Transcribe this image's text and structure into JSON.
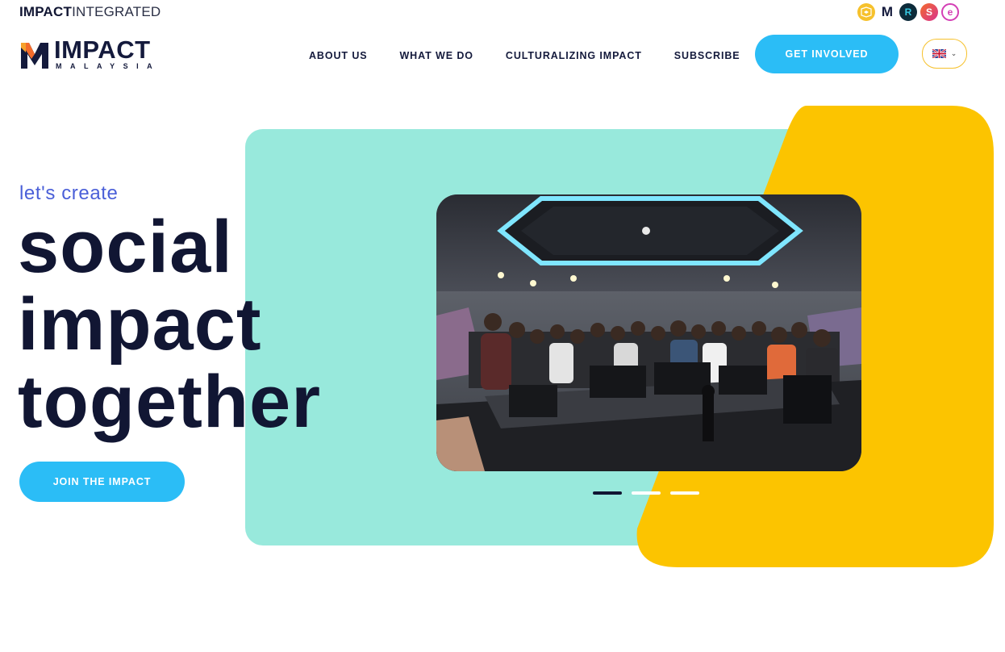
{
  "topbar": {
    "brand_bold": "IMPACT",
    "brand_light": "INTEGRATED",
    "brand_icons": [
      {
        "name": "mobius-icon",
        "glyph": "⟳",
        "color": "#f6c12c"
      },
      {
        "name": "impact-m-icon",
        "glyph": "M",
        "color": "#141a3c"
      },
      {
        "name": "r-brand-icon",
        "glyph": "R",
        "color": "#0b6f8a"
      },
      {
        "name": "s-brand-icon",
        "glyph": "S",
        "color": "#e54b4b"
      },
      {
        "name": "e-brand-icon",
        "glyph": "e",
        "color": "#d43fb5"
      }
    ]
  },
  "logo": {
    "title": "IMPACT",
    "subtitle": "MALAYSIA"
  },
  "nav": {
    "items": [
      "ABOUT US",
      "WHAT WE DO",
      "CULTURALIZING IMPACT",
      "SUBSCRIBE"
    ],
    "cta_label": "GET INVOLVED",
    "language_flag": "uk-flag-icon"
  },
  "hero": {
    "eyebrow": "let's create",
    "headline_lines": [
      "social",
      "impact",
      "together"
    ],
    "button_label": "JOIN THE IMPACT",
    "slides_total": 3,
    "active_slide": 1
  },
  "colors": {
    "accent_blue": "#2bbdf6",
    "teal": "#98e9dc",
    "yellow": "#fcc400",
    "navy": "#111633",
    "eyebrow": "#4a5fd8"
  }
}
